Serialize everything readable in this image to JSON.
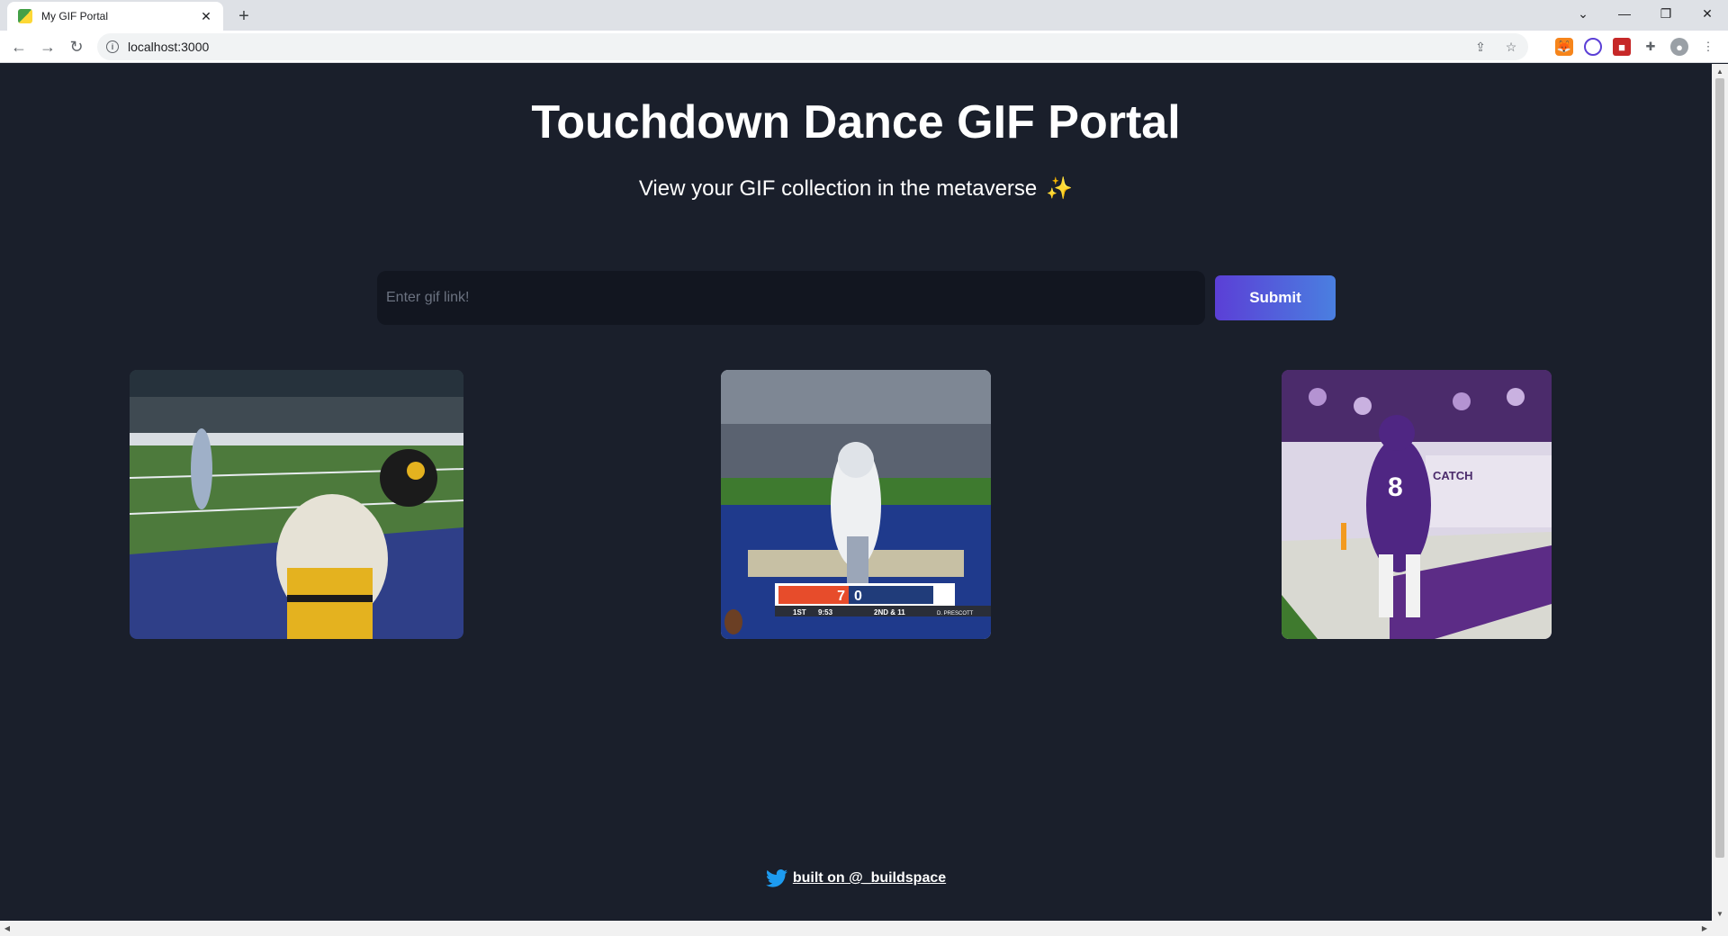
{
  "browser": {
    "tab_title": "My GIF Portal",
    "url": "localhost:3000"
  },
  "page": {
    "title": "Touchdown Dance GIF Portal",
    "subtitle": "View your GIF collection in the metaverse",
    "subtitle_emoji": "✨",
    "input_placeholder": "Enter gif link!",
    "input_value": "",
    "submit_label": "Submit",
    "footer_link": "built on @_buildspace"
  },
  "gifs": [
    {
      "alt": "steelers-player-dance-gif"
    },
    {
      "alt": "cowboys-player-dance-gif",
      "scoreboard": {
        "away": "7",
        "home": "0",
        "quarter": "1ST",
        "clock": "9:53",
        "down": "2ND & 11",
        "player": "D. PRESCOTT"
      }
    },
    {
      "alt": "vikings-qb-dance-gif",
      "jersey": "8",
      "banner": "CATCH"
    }
  ],
  "colors": {
    "background": "#1a1f2b",
    "input_bg": "#121620",
    "button_gradient": [
      "#5b3fd6",
      "#4a7fe0"
    ],
    "twitter_blue": "#1d9bf0"
  }
}
